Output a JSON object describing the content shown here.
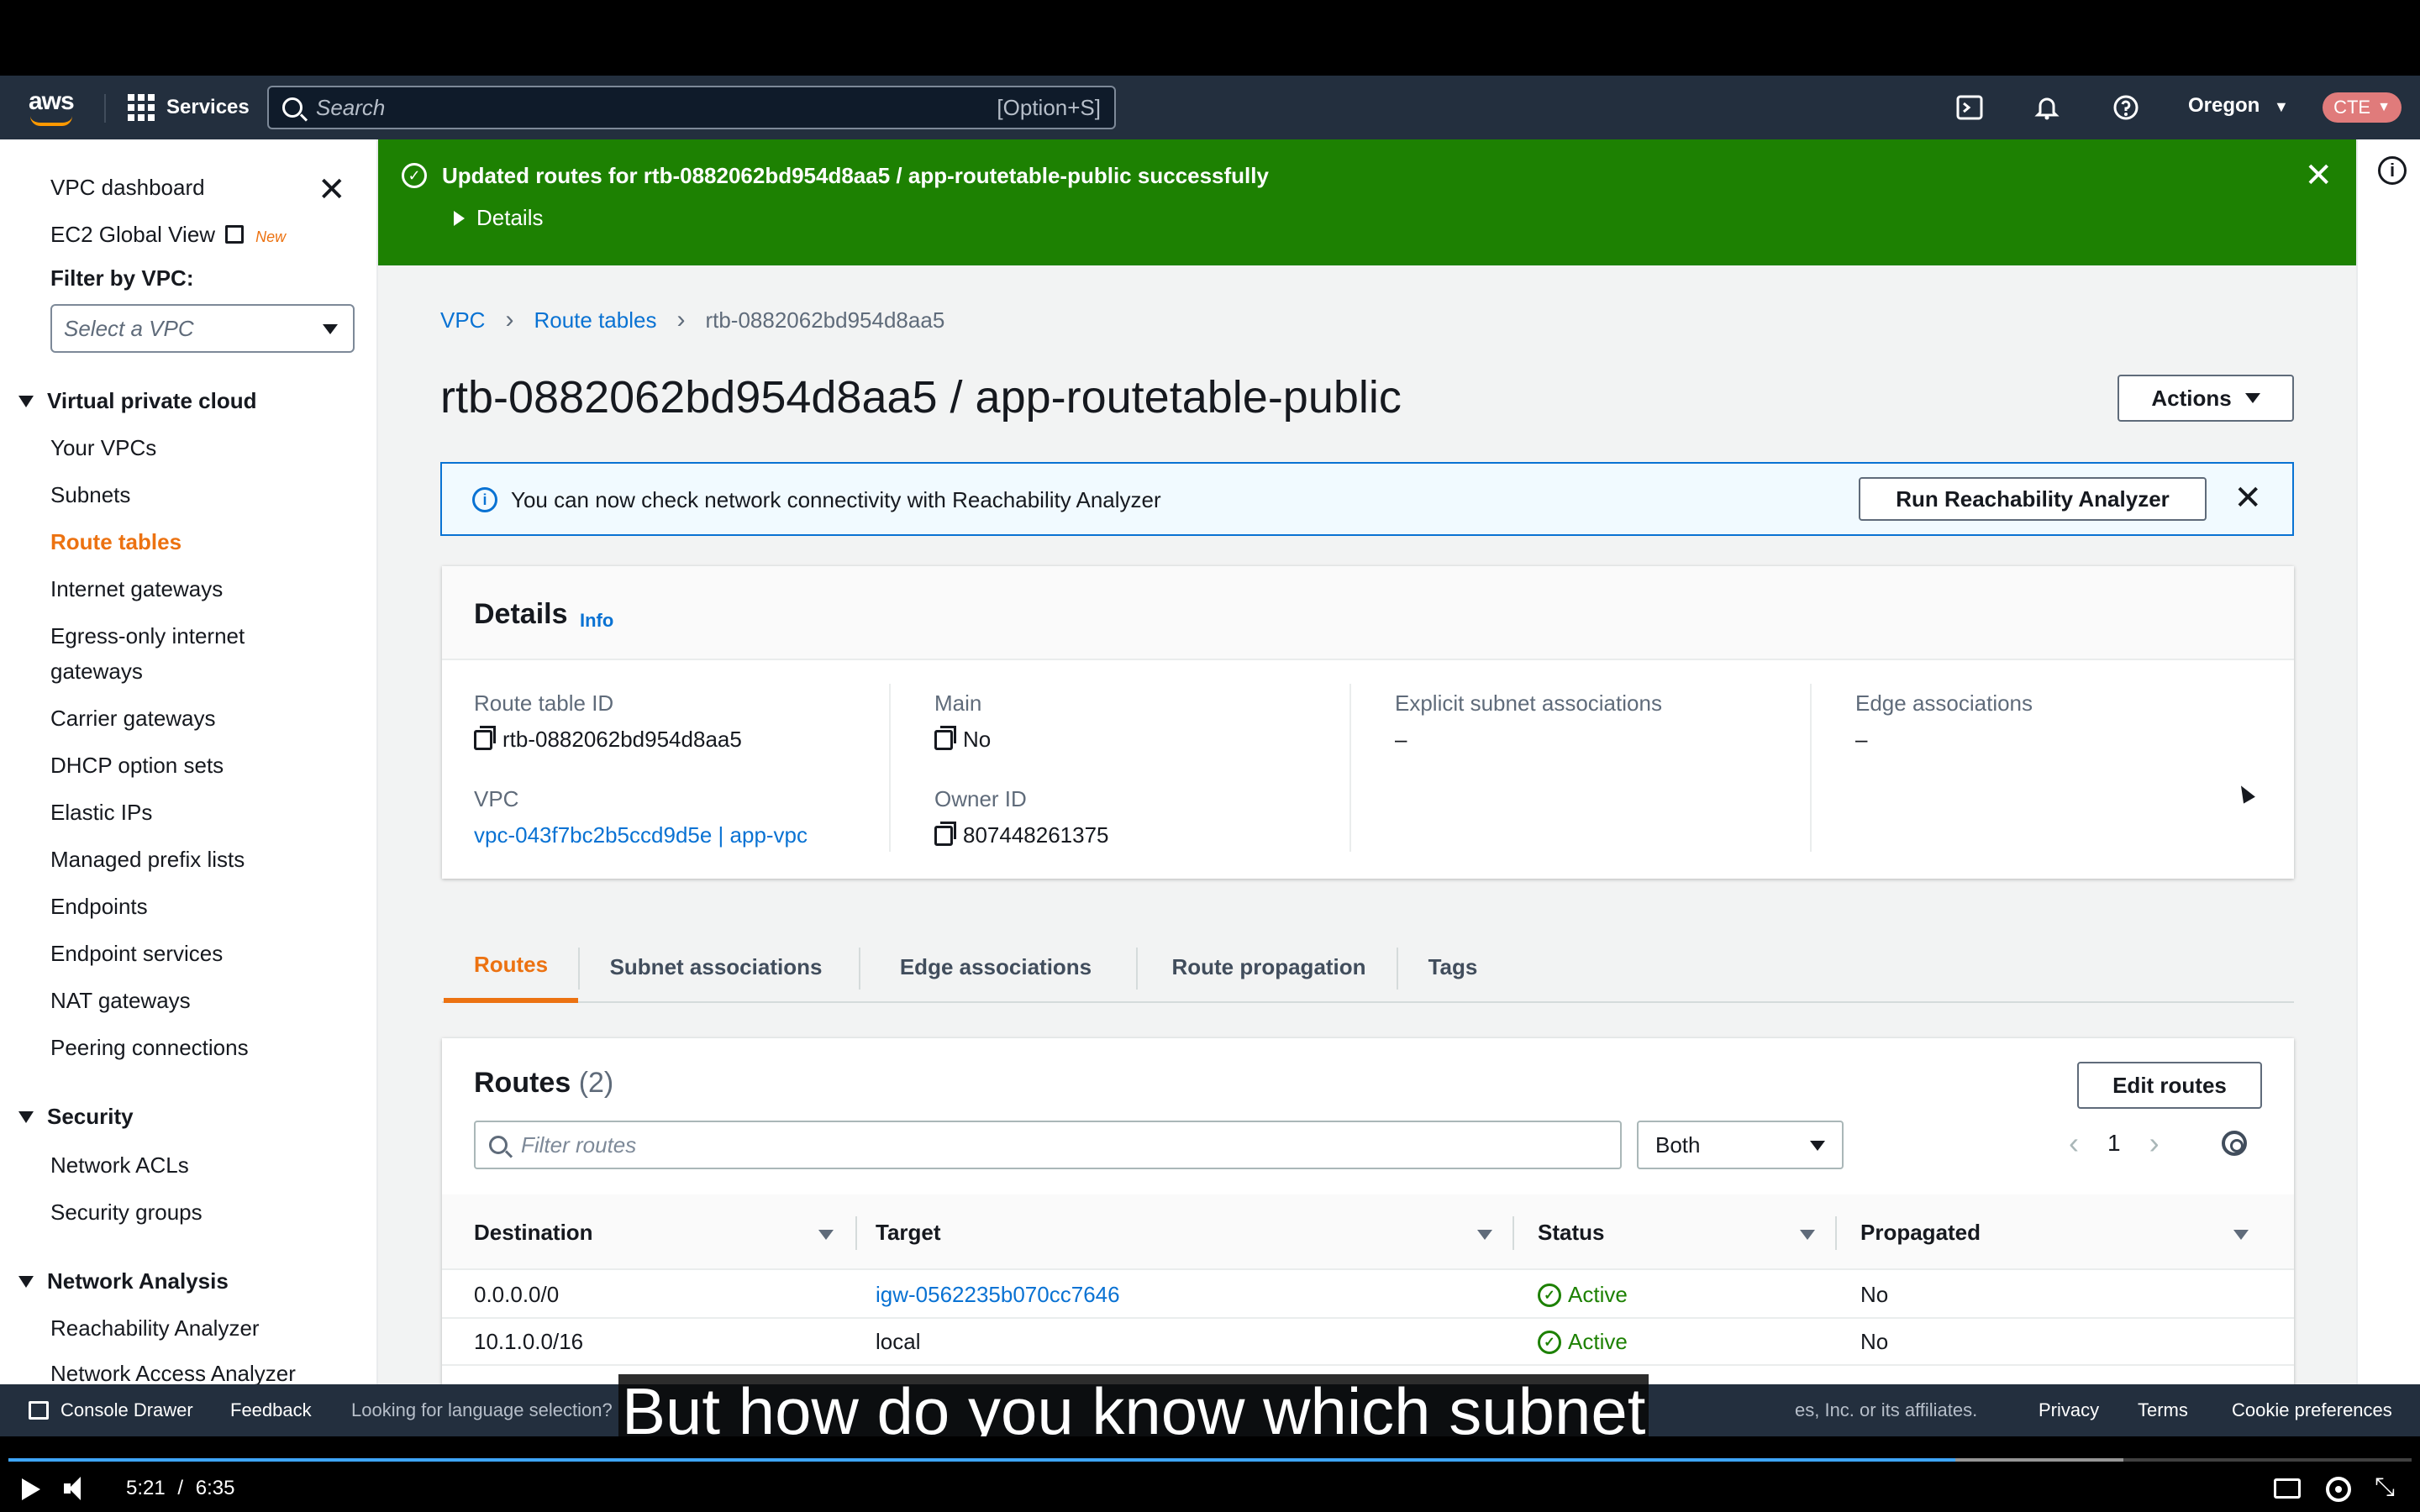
{
  "nav": {
    "logo": "aws",
    "services": "Services",
    "search_placeholder": "Search",
    "search_shortcut": "[Option+S]",
    "region": "Oregon",
    "account": "CTE"
  },
  "sidebar": {
    "top_items": [
      "VPC dashboard",
      "EC2 Global View"
    ],
    "new_badge": "New",
    "filter_label": "Filter by VPC:",
    "filter_placeholder": "Select a VPC",
    "sections": [
      {
        "title": "Virtual private cloud",
        "items": [
          "Your VPCs",
          "Subnets",
          "Route tables",
          "Internet gateways",
          "Egress-only internet",
          "gateways",
          "Carrier gateways",
          "DHCP option sets",
          "Elastic IPs",
          "Managed prefix lists",
          "Endpoints",
          "Endpoint services",
          "NAT gateways",
          "Peering connections"
        ]
      },
      {
        "title": "Security",
        "items": [
          "Network ACLs",
          "Security groups"
        ]
      },
      {
        "title": "Network Analysis",
        "items": [
          "Reachability Analyzer",
          "Network Access Analyzer"
        ]
      }
    ],
    "active_item": "Route tables"
  },
  "flash": {
    "message": "Updated routes for rtb-0882062bd954d8aa5 / app-routetable-public successfully",
    "details": "Details"
  },
  "breadcrumb": [
    "VPC",
    "Route tables",
    "rtb-0882062bd954d8aa5"
  ],
  "page_title": "rtb-0882062bd954d8aa5 / app-routetable-public",
  "actions_label": "Actions",
  "info_alert": {
    "text": "You can now check network connectivity with Reachability Analyzer",
    "button": "Run Reachability Analyzer"
  },
  "details": {
    "title": "Details",
    "info": "Info",
    "route_table_id_label": "Route table ID",
    "route_table_id": "rtb-0882062bd954d8aa5",
    "main_label": "Main",
    "main": "No",
    "explicit_label": "Explicit subnet associations",
    "explicit": "–",
    "edge_label": "Edge associations",
    "edge": "–",
    "vpc_label": "VPC",
    "vpc": "vpc-043f7bc2b5ccd9d5e | app-vpc",
    "owner_label": "Owner ID",
    "owner": "807448261375"
  },
  "tabs": [
    "Routes",
    "Subnet associations",
    "Edge associations",
    "Route propagation",
    "Tags"
  ],
  "routes": {
    "title": "Routes",
    "count": "(2)",
    "edit_button": "Edit routes",
    "filter_placeholder": "Filter routes",
    "filter_select": "Both",
    "page": "1",
    "columns": [
      "Destination",
      "Target",
      "Status",
      "Propagated"
    ],
    "rows": [
      {
        "destination": "0.0.0.0/0",
        "target": "igw-0562235b070cc7646",
        "status": "Active",
        "propagated": "No"
      },
      {
        "destination": "10.1.0.0/16",
        "target": "local",
        "status": "Active",
        "propagated": "No"
      }
    ]
  },
  "footer": {
    "drawer": "Console Drawer",
    "feedback": "Feedback",
    "language": "Looking for language selection?",
    "copyright": "es, Inc. or its affiliates.",
    "links": [
      "Privacy",
      "Terms",
      "Cookie preferences"
    ]
  },
  "caption": "But how do you know which subnet",
  "video": {
    "current_time": "5:21",
    "separator": "/",
    "duration": "6:35",
    "progress_fraction": 0.81,
    "buffered_fraction": 0.88
  }
}
